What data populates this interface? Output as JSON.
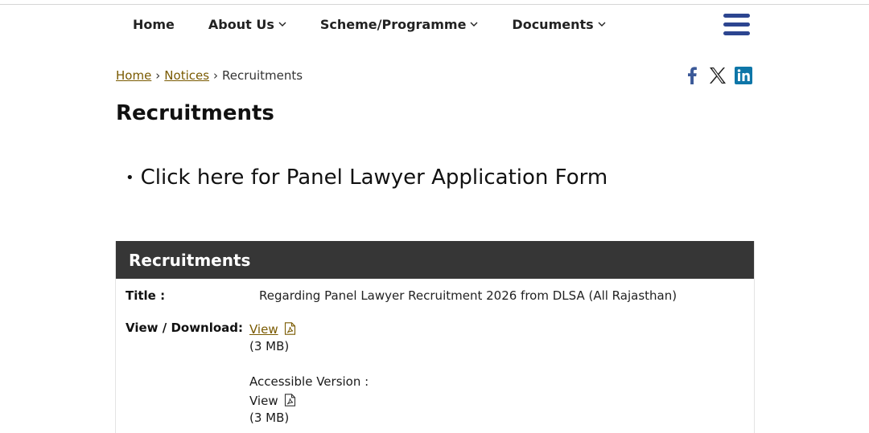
{
  "nav": {
    "items": [
      {
        "label": "Home",
        "has_dropdown": false
      },
      {
        "label": "About Us",
        "has_dropdown": true
      },
      {
        "label": "Scheme/Programme",
        "has_dropdown": true
      },
      {
        "label": "Documents",
        "has_dropdown": true
      }
    ],
    "menu_icon": "hamburger-menu-icon",
    "menu_color": "#2c4590"
  },
  "breadcrumb": {
    "home": "Home",
    "notices": "Notices",
    "current": "Recruitments",
    "separator": "›"
  },
  "social": [
    "facebook-icon",
    "x-twitter-icon",
    "linkedin-icon"
  ],
  "page": {
    "title": "Recruitments",
    "bullet_link": "Click here for Panel Lawyer Application Form"
  },
  "table": {
    "heading": "Recruitments",
    "title_label": "Title :",
    "title_value": "Regarding Panel Lawyer Recruitment 2026 from DLSA (All Rajasthan)",
    "download_label": "View / Download:",
    "view_label": "View",
    "size_1": "(3 MB)",
    "accessible_label": "Accessible Version :",
    "view_label_2": "View",
    "size_2": "(3 MB)"
  },
  "colors": {
    "header_bg": "#363636",
    "link": "#7a5a00",
    "facebook": "#3b5998",
    "linkedin": "#0e76a8"
  }
}
